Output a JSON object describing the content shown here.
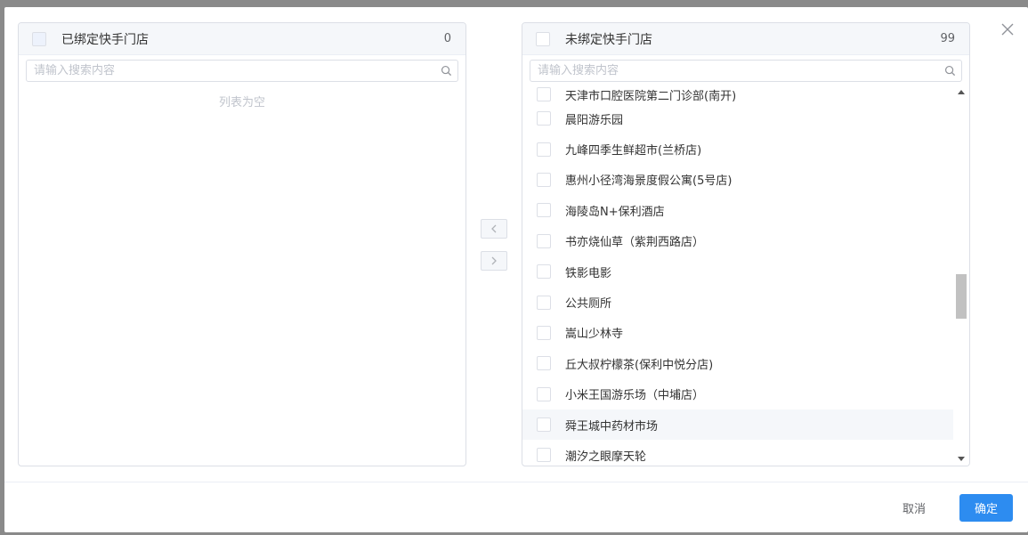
{
  "left_panel": {
    "title": "已绑定快手门店",
    "count": "0",
    "search_placeholder": "请输入搜索内容",
    "empty_text": "列表为空"
  },
  "right_panel": {
    "title": "未绑定快手门店",
    "count": "99",
    "search_placeholder": "请输入搜索内容",
    "items": [
      "天津市口腔医院第二门诊部(南开)",
      "晨阳游乐园",
      "九峰四季生鲜超市(兰桥店)",
      "惠州小径湾海景度假公寓(5号店)",
      "海陵岛N+保利酒店",
      "书亦烧仙草（紫荆西路店）",
      "铁影电影",
      "公共厕所",
      "嵩山少林寺",
      "丘大叔柠檬茶(保利中悦分店)",
      "小米王国游乐场（中埔店）",
      "舜王城中药材市场",
      "潮汐之眼摩天轮"
    ],
    "hovered_index": 11
  },
  "transfer": {
    "to_left_icon": "chevron-left-icon",
    "to_right_icon": "chevron-right-icon"
  },
  "footer": {
    "cancel_label": "取消",
    "ok_label": "确定"
  },
  "colors": {
    "primary": "#2d8cf0",
    "border": "#dcdfe6",
    "header_bg": "#f5f7fa"
  }
}
